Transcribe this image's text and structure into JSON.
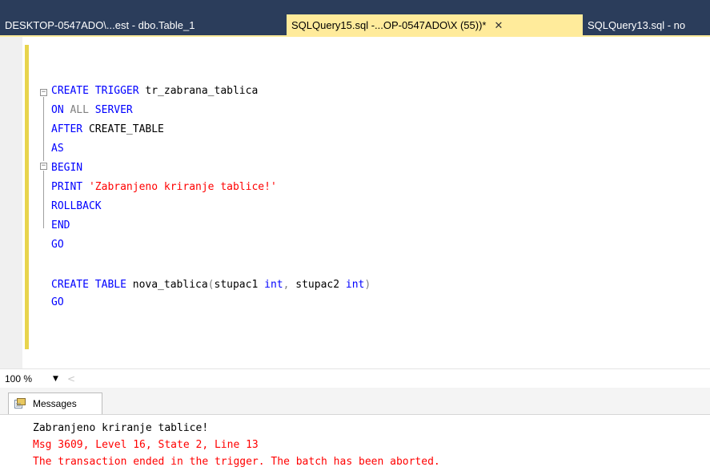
{
  "tabs": [
    {
      "label": "DESKTOP-0547ADO\\...est - dbo.Table_1",
      "active": false
    },
    {
      "label": "SQLQuery15.sql -...OP-0547ADO\\X (55))*",
      "active": true,
      "close": "✕"
    },
    {
      "label": "SQLQuery13.sql - no",
      "active": false
    }
  ],
  "code": {
    "lines": [
      [
        {
          "t": "CREATE TRIGGER",
          "c": "kw"
        },
        {
          "t": " tr_zabrana_tablica",
          "c": "plain"
        }
      ],
      [
        {
          "t": "ON",
          "c": "kw"
        },
        {
          "t": " ",
          "c": "plain"
        },
        {
          "t": "ALL",
          "c": "gray"
        },
        {
          "t": " SERVER",
          "c": "kw"
        }
      ],
      [
        {
          "t": "AFTER",
          "c": "kw"
        },
        {
          "t": " CREATE_TABLE",
          "c": "plain"
        }
      ],
      [
        {
          "t": "AS",
          "c": "kw"
        }
      ],
      [
        {
          "t": "BEGIN",
          "c": "kw"
        }
      ],
      [
        {
          "t": "PRINT",
          "c": "kw"
        },
        {
          "t": " ",
          "c": "plain"
        },
        {
          "t": "'Zabranjeno kriranje tablice!'",
          "c": "str"
        }
      ],
      [
        {
          "t": "ROLLBACK",
          "c": "kw"
        }
      ],
      [
        {
          "t": "END",
          "c": "kw"
        }
      ],
      [
        {
          "t": "GO",
          "c": "kw"
        }
      ],
      [],
      [
        {
          "t": "CREATE TABLE",
          "c": "kw"
        },
        {
          "t": " nova_tablica",
          "c": "plain"
        },
        {
          "t": "(",
          "c": "gray"
        },
        {
          "t": "stupac1 ",
          "c": "plain"
        },
        {
          "t": "int",
          "c": "kw"
        },
        {
          "t": ",",
          "c": "gray"
        },
        {
          "t": " stupac2 ",
          "c": "plain"
        },
        {
          "t": "int",
          "c": "kw"
        },
        {
          "t": ")",
          "c": "gray"
        }
      ],
      [
        {
          "t": "GO",
          "c": "kw"
        }
      ]
    ]
  },
  "statusbar": {
    "zoom": "100 %",
    "zoom_arrow": "▼",
    "scroll_left": "<"
  },
  "messages": {
    "tab_label": "Messages",
    "lines": [
      {
        "text": "Zabranjeno kriranje tablice!",
        "type": "ok"
      },
      {
        "text": "Msg 3609, Level 16, State 2, Line 13",
        "type": "error"
      },
      {
        "text": "The transaction ended in the trigger. The batch has been aborted.",
        "type": "error"
      }
    ]
  },
  "colors": {
    "tab_active": "#ffeb9b",
    "tab_bg": "#2b3d5b",
    "keyword": "#0000ff",
    "string": "#ff0000",
    "change_bar": "#e8d44d"
  }
}
